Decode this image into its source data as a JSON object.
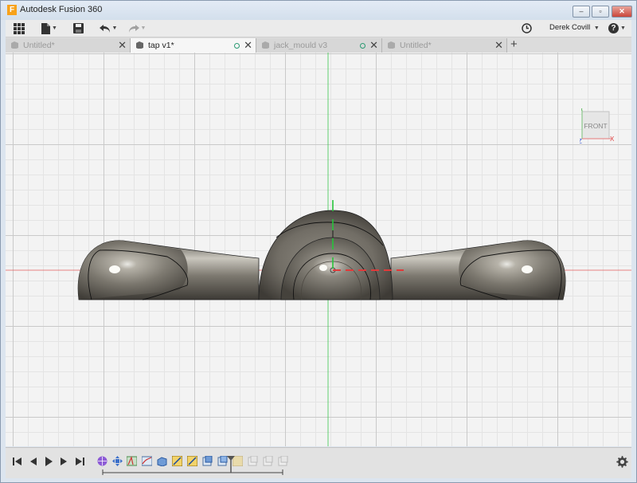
{
  "window": {
    "title": "Autodesk Fusion 360",
    "minimize_glyph": "‒",
    "maximize_glyph": "▫",
    "close_glyph": "✕"
  },
  "toolbar": {
    "icons": [
      "app-grid-icon",
      "file-icon",
      "save-icon",
      "undo-icon",
      "redo-icon",
      "clock-icon",
      "help-icon"
    ],
    "user_name": "Derek Covill",
    "help_label": "?"
  },
  "tabs": [
    {
      "label": "Untitled*",
      "active": false,
      "has_status_dot": false
    },
    {
      "label": "tap v1*",
      "active": true,
      "has_status_dot": true
    },
    {
      "label": "jack_mould v3",
      "active": false,
      "has_status_dot": true
    },
    {
      "label": "Untitled*",
      "active": false,
      "has_status_dot": false
    }
  ],
  "tab_close_glyph": "✕",
  "tab_add_glyph": "+",
  "viewcube": {
    "face_label": "FRONT",
    "axis_x": "X",
    "axis_y": "Y",
    "axis_z": "Z"
  },
  "colors": {
    "model_body": "#7c786f",
    "x_axis": "#e03a3a",
    "y_axis": "#26c43a",
    "grid_major": "#c9c9c9",
    "grid_minor": "#e4e4e4"
  },
  "timeline": {
    "playback": [
      "skip-to-start-icon",
      "step-back-icon",
      "play-icon",
      "step-forward-icon",
      "skip-to-end-icon"
    ],
    "feature_count": 15,
    "settings_icon": "gear-icon"
  }
}
